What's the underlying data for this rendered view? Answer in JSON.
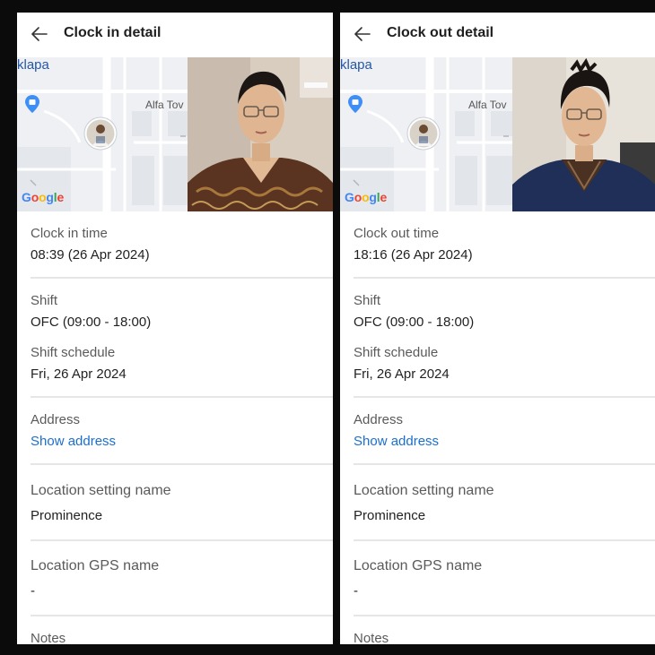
{
  "clock_in": {
    "title": "Clock in detail",
    "map": {
      "place_label": "klapa",
      "poi_label": "Alfa Tov",
      "provider": "Google"
    },
    "time_label": "Clock in time",
    "time_value": "08:39 (26 Apr 2024)",
    "shift_label": "Shift",
    "shift_value": "OFC (09:00 - 18:00)",
    "schedule_label": "Shift schedule",
    "schedule_value": "Fri, 26 Apr 2024",
    "address_label": "Address",
    "address_link": "Show address",
    "location_setting_label": "Location setting name",
    "location_setting_value": "Prominence",
    "gps_label": "Location GPS name",
    "gps_value": "-",
    "notes_label": "Notes"
  },
  "clock_out": {
    "title": "Clock out detail",
    "map": {
      "place_label": "klapa",
      "poi_label": "Alfa Tov",
      "provider": "Google"
    },
    "time_label": "Clock out time",
    "time_value": "18:16 (26 Apr 2024)",
    "shift_label": "Shift",
    "shift_value": "OFC (09:00 - 18:00)",
    "schedule_label": "Shift schedule",
    "schedule_value": "Fri, 26 Apr 2024",
    "address_label": "Address",
    "address_link": "Show address",
    "location_setting_label": "Location setting name",
    "location_setting_value": "Prominence",
    "gps_label": "Location GPS name",
    "gps_value": "-",
    "notes_label": "Notes"
  },
  "colors": {
    "link": "#1a6fd1",
    "map_pin": "#3d8ef7",
    "divider": "#e6e6e6"
  },
  "icons": {
    "back": "arrow-left-icon",
    "pin": "map-pin-icon"
  }
}
